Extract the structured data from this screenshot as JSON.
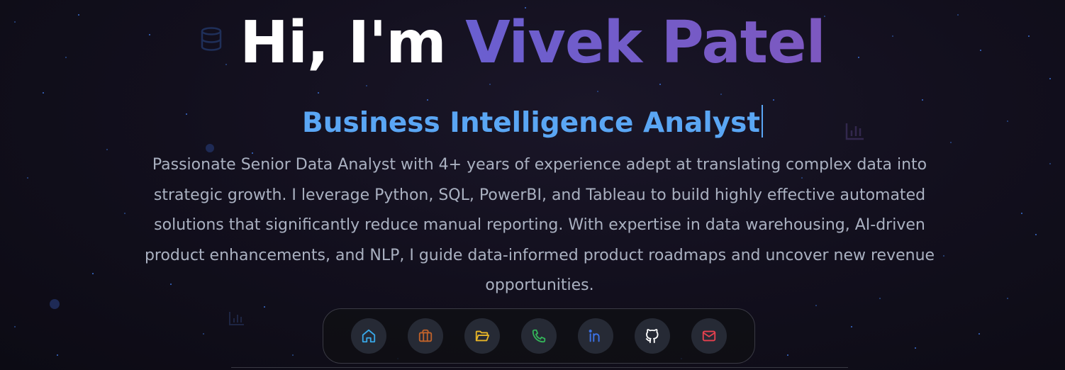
{
  "hero": {
    "greeting": "Hi, I'm ",
    "name": "Vivek Patel",
    "role": "Business Intelligence Analyst",
    "intro": "Passionate Senior Data Analyst with 4+ years of experience adept at translating complex data into strategic growth. I leverage Python, SQL, PowerBI, and Tableau to build highly effective automated solutions that significantly reduce manual reporting. With expertise in data warehousing, AI-driven product enhancements, and NLP, I guide data-informed product roadmaps and uncover new revenue opportunities."
  },
  "dock": {
    "items": [
      {
        "icon": "home-icon",
        "color": "#38a8e8"
      },
      {
        "icon": "briefcase-icon",
        "color": "#c0622a"
      },
      {
        "icon": "folder-open-icon",
        "color": "#e8b628"
      },
      {
        "icon": "phone-icon",
        "color": "#34b55a"
      },
      {
        "icon": "linkedin-icon",
        "color": "#3b6fe0"
      },
      {
        "icon": "github-icon",
        "color": "#ffffff"
      },
      {
        "icon": "mail-icon",
        "color": "#e8414f"
      }
    ]
  },
  "background": {
    "decorative_icons": [
      "database-icon",
      "bar-chart-icon",
      "bar-chart-icon"
    ],
    "accent_colors": {
      "name_gradient_start": "#6a5fd0",
      "name_gradient_end": "#7d58c0",
      "role": "#5aa6f4",
      "intro_text": "#aab1c1"
    }
  }
}
